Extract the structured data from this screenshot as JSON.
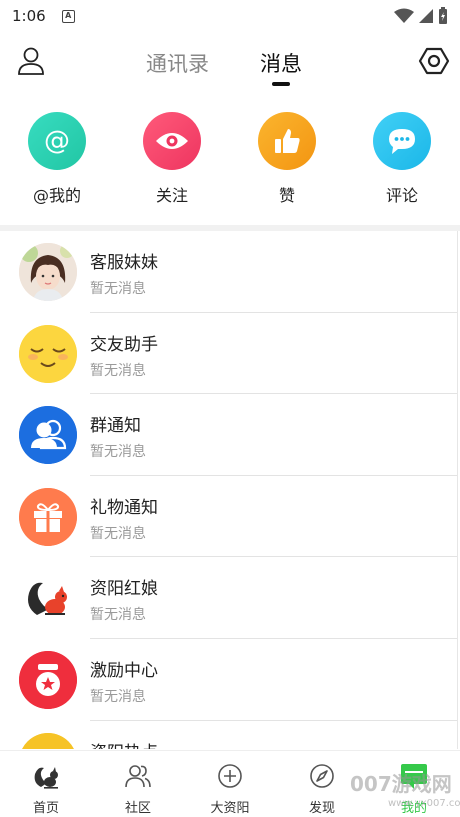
{
  "status_bar": {
    "time": "1:06",
    "notification_letter": "A"
  },
  "header": {
    "tabs": [
      {
        "label": "通讯录",
        "active": false
      },
      {
        "label": "消息",
        "active": true
      }
    ]
  },
  "quick_actions": [
    {
      "label": "@我的",
      "icon": "at-icon",
      "color": "#2ed3b1"
    },
    {
      "label": "关注",
      "icon": "eye-icon",
      "color": "#f5446a"
    },
    {
      "label": "赞",
      "icon": "thumbs-up-icon",
      "color": "#f9a21b"
    },
    {
      "label": "评论",
      "icon": "comment-icon",
      "color": "#2cc3ef"
    }
  ],
  "messages": [
    {
      "title": "客服妹妹",
      "subtitle": "暂无消息",
      "avatar": "photo-avatar"
    },
    {
      "title": "交友助手",
      "subtitle": "暂无消息",
      "avatar": "smiley-avatar"
    },
    {
      "title": "群通知",
      "subtitle": "暂无消息",
      "avatar": "group-avatar"
    },
    {
      "title": "礼物通知",
      "subtitle": "暂无消息",
      "avatar": "gift-avatar"
    },
    {
      "title": "资阳红娘",
      "subtitle": "暂无消息",
      "avatar": "squirrel-avatar"
    },
    {
      "title": "激励中心",
      "subtitle": "暂无消息",
      "avatar": "reward-avatar"
    },
    {
      "title": "资阳热点",
      "subtitle": "",
      "avatar": "hot-avatar"
    }
  ],
  "bottom_nav": [
    {
      "label": "首页",
      "icon": "squirrel-icon"
    },
    {
      "label": "社区",
      "icon": "people-icon"
    },
    {
      "label": "大资阳",
      "icon": "plus-circle-icon"
    },
    {
      "label": "发现",
      "icon": "compass-icon"
    },
    {
      "label": "我的",
      "icon": "chat-icon"
    }
  ],
  "watermark": {
    "text": "007游戏网",
    "sub": "www.yx007.com"
  },
  "colors": {
    "accent_dark": "#111111",
    "muted_text": "#9a9a9a"
  }
}
